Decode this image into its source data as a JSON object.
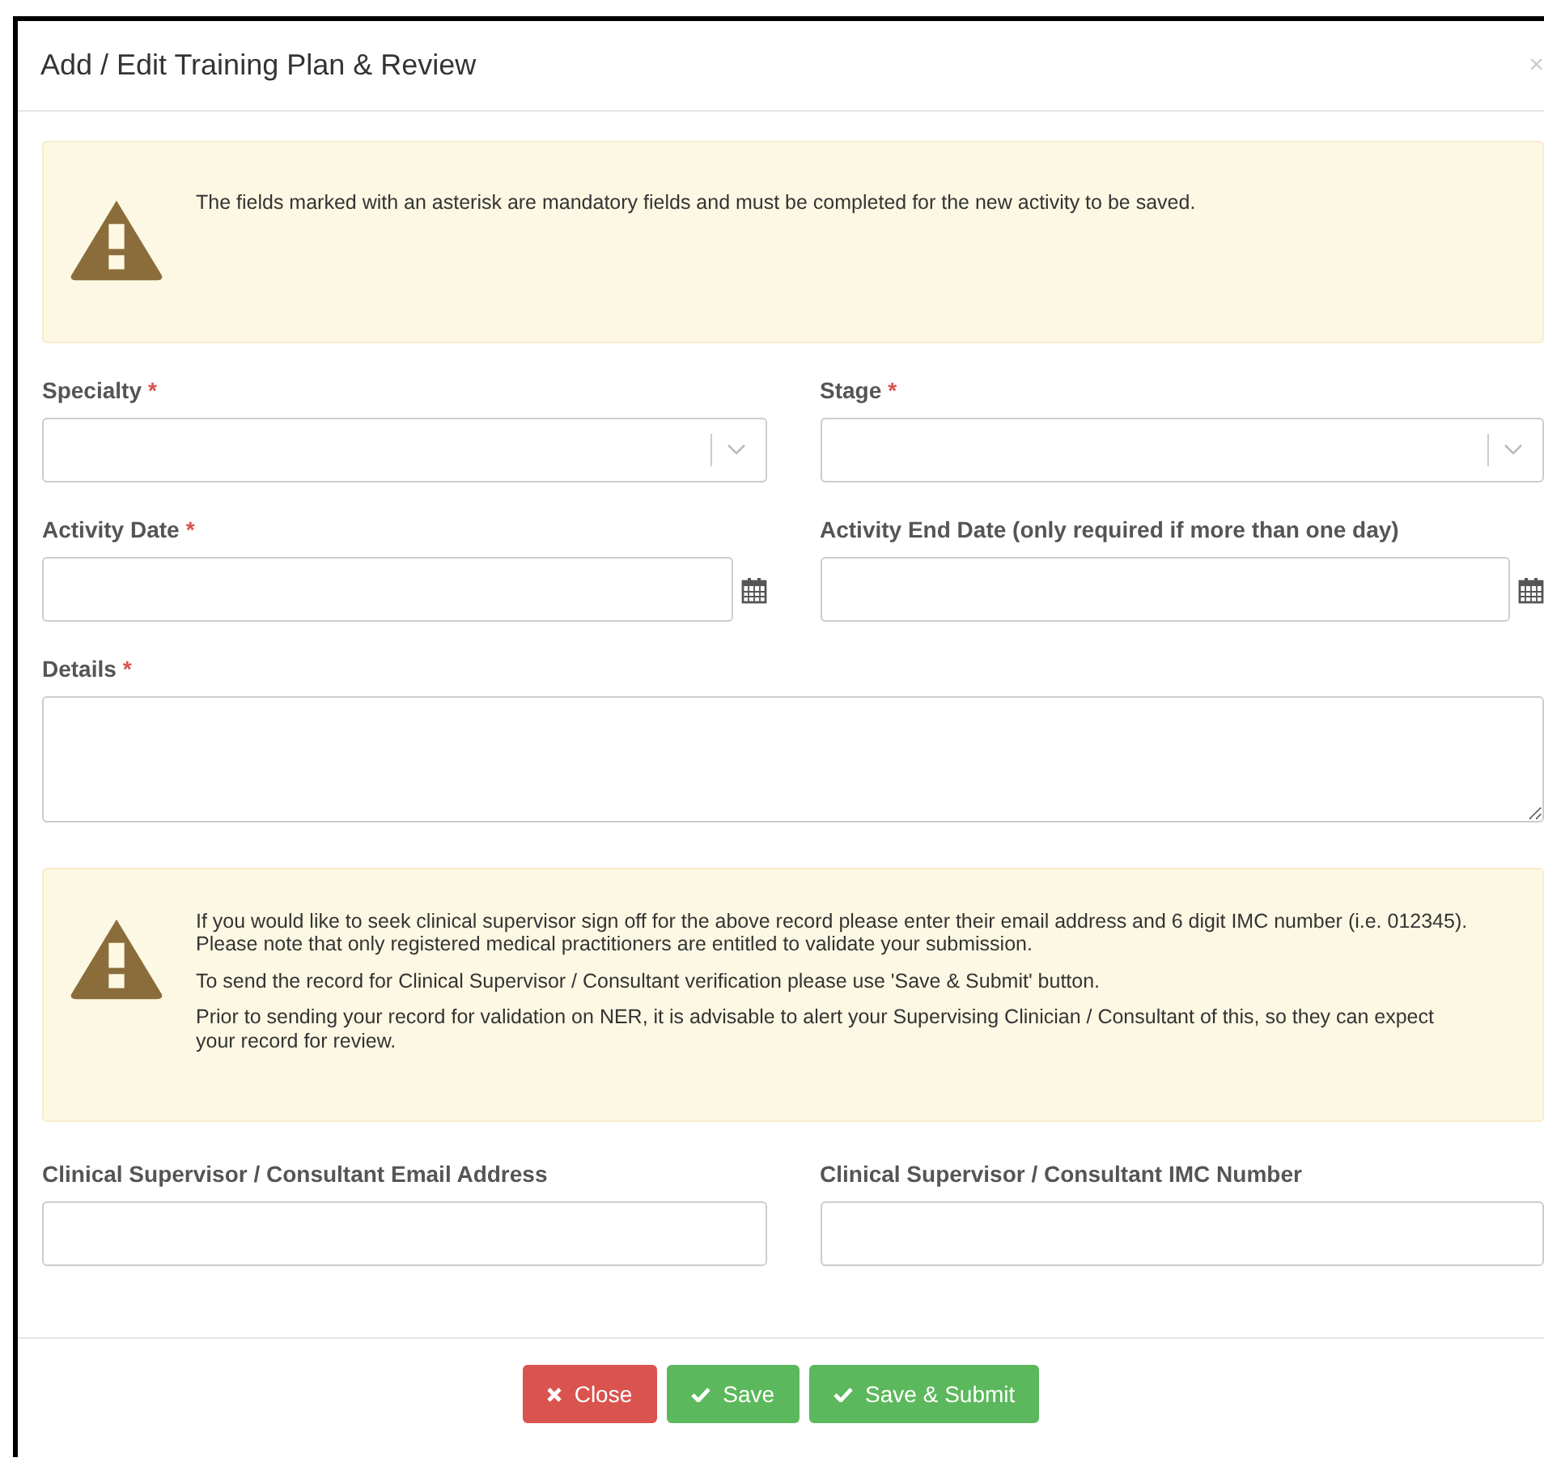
{
  "window": {
    "title": "Add / Edit Training Plan & Review",
    "close": "×"
  },
  "notice": {
    "paragraphs": [
      "The fields marked with an asterisk are mandatory fields and must be completed for the new activity to be saved."
    ]
  },
  "field_rows": [
    {
      "fields": [
        {
          "kind": "select",
          "label": "Specialty",
          "mark": "*"
        },
        {
          "kind": "select",
          "label": "Stage",
          "mark": "*"
        }
      ]
    },
    {
      "fields": [
        {
          "kind": "date",
          "label": "Activity Date",
          "mark": "*"
        },
        {
          "kind": "date",
          "label": "Activity End Date (only required if more than one day)"
        }
      ]
    },
    {
      "fields": [
        {
          "kind": "textarea",
          "label": "Details",
          "mark": "*"
        }
      ]
    }
  ],
  "supervisor_notice": {
    "paragraphs": [
      "If you would like to seek clinical supervisor sign off for the above record please enter their email address and 6 digit IMC number (i.e. 012345). Please note that only registered medical practitioners are entitled to validate your submission.",
      "To send the record for Clinical Supervisor / Consultant verification please use 'Save & Submit' button.",
      "Prior to sending your record for validation on NER, it is advisable to alert your Supervising Clinician / Consultant of this, so they can expect your record for review."
    ]
  },
  "supervisor_fields": [
    {
      "kind": "text",
      "label": "Clinical Supervisor / Consultant Email Address"
    },
    {
      "kind": "text",
      "label": "Clinical Supervisor / Consultant IMC Number"
    }
  ],
  "buttons": [
    {
      "kind": "danger",
      "label": "Close"
    },
    {
      "kind": "success",
      "label": "Save"
    },
    {
      "kind": "success",
      "label": "Save & Submit"
    }
  ]
}
